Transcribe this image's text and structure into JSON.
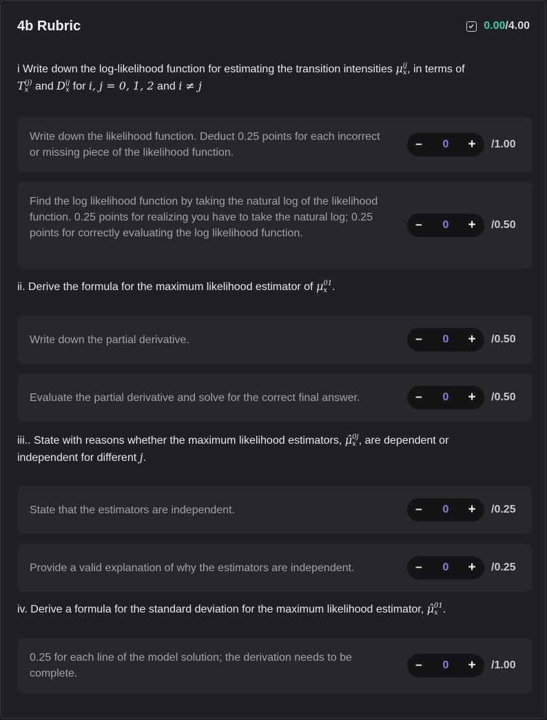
{
  "header": {
    "title": "4b Rubric",
    "score": "0.00",
    "score_max": "/4.00"
  },
  "questions": [
    {
      "text_before": "i Write down the log-likelihood function for estimating the transition intensities"
    },
    {
      "text_before": "ii. Derive the formula for the maximum likelihood estimator of"
    },
    {
      "text_before": "iii.. State with reasons whether the maximum likelihood estimators,"
    },
    {
      "text_before": "iv. Derive a formula for the standard deviation for the maximum likelihood estimator,"
    }
  ],
  "criteria": [
    {
      "text": "Write down the likelihood function. Deduct 0.25 points for each incorrect or missing piece of the likelihood function.",
      "value": "0",
      "max": "/1.00"
    },
    {
      "text": "Find the log likelihood function by taking the natural log of the likelihood function. 0.25 points for realizing you have to take the natural log; 0.25 points for correctly evaluating the log likelihood function.",
      "value": "0",
      "max": "/0.50"
    },
    {
      "text": "Write down the partial derivative.",
      "value": "0",
      "max": "/0.50"
    },
    {
      "text": "Evaluate the partial derivative and solve for the correct final answer.",
      "value": "0",
      "max": "/0.50"
    },
    {
      "text": "State that the estimators are independent.",
      "value": "0",
      "max": "/0.25"
    },
    {
      "text": "Provide a valid explanation of why the estimators are independent.",
      "value": "0",
      "max": "/0.25"
    },
    {
      "text": "0.25 for each line of the model solution; the derivation needs to be complete.",
      "value": "0",
      "max": "/1.00"
    }
  ],
  "stepper": {
    "minus": "−",
    "plus": "+"
  },
  "accent_colors": {
    "score": "#3ecfa4",
    "value": "#8a7fe0"
  }
}
